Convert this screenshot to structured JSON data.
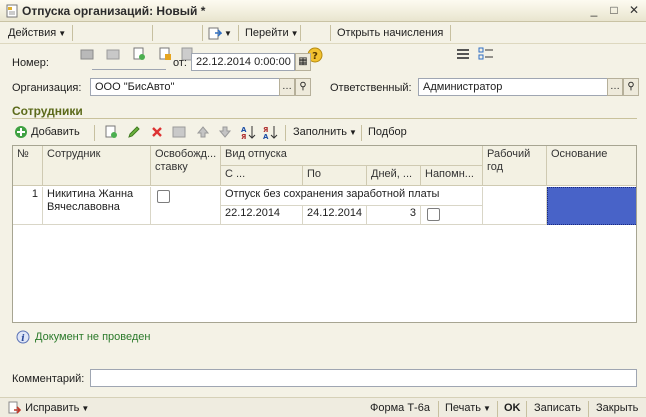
{
  "window": {
    "title": "Отпуска организаций: Новый *"
  },
  "toolbar": {
    "actions_label": "Действия",
    "goto_label": "Перейти",
    "open_accruals_label": "Открыть начисления"
  },
  "header": {
    "number_label": "Номер:",
    "number_value": "",
    "date_label": "от:",
    "date_value": "22.12.2014  0:00:00",
    "org_label": "Организация:",
    "org_value": "ООО \"БисАвто\"",
    "responsible_label": "Ответственный:",
    "responsible_value": "Администратор"
  },
  "employees": {
    "section_title": "Сотрудники",
    "add_label": "Добавить",
    "fill_label": "Заполнить",
    "select_label": "Подбор",
    "columns": {
      "num": "№",
      "employee": "Сотрудник",
      "release_rate": "Освобожд... ставку",
      "vacation_type": "Вид отпуска",
      "from": "С ...",
      "to": "По",
      "days": "Дней, ...",
      "remind": "Напомн...",
      "work_year": "Рабочий год",
      "basis": "Основание"
    },
    "rows": [
      {
        "num": "1",
        "employee": "Никитина Жанна Вячеславовна",
        "vacation_type": "Отпуск без сохранения заработной платы",
        "from": "22.12.2014",
        "to": "24.12.2014",
        "days": "3"
      }
    ]
  },
  "status": {
    "not_posted": "Документ не проведен"
  },
  "comment": {
    "label": "Комментарий:",
    "value": ""
  },
  "bottom": {
    "fix_label": "Исправить",
    "form_label": "Форма Т-6а",
    "print_label": "Печать",
    "ok_label": "OK",
    "save_label": "Записать",
    "close_label": "Закрыть"
  },
  "colors": {
    "accent": "#5c6a1a",
    "selected_cell": "#4863c8",
    "status_green": "#2b7a2b"
  }
}
